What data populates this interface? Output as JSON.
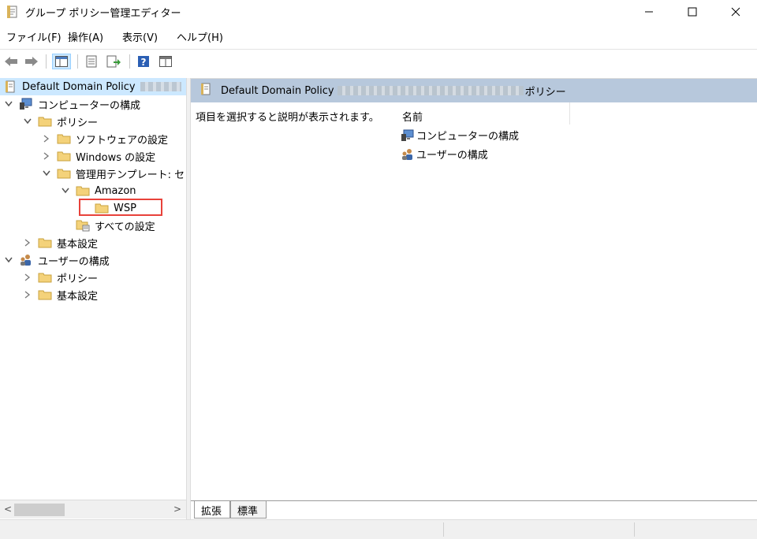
{
  "window": {
    "title": "グループ ポリシー管理エディター"
  },
  "menu": [
    "ファイル(F)",
    "操作(A)",
    "表示(V)",
    "ヘルプ(H)"
  ],
  "tree": {
    "root_label": "Default Domain Policy",
    "items": [
      {
        "label": "コンピューターの構成",
        "expander": "expanded"
      },
      {
        "label": "ポリシー",
        "expander": "expanded"
      },
      {
        "label": "ソフトウェアの設定",
        "expander": "collapsed"
      },
      {
        "label": "Windows の設定",
        "expander": "collapsed"
      },
      {
        "label": "管理用テンプレート: セン",
        "expander": "expanded"
      },
      {
        "label": "Amazon",
        "expander": "expanded"
      },
      {
        "label": "WSP",
        "expander": "none"
      },
      {
        "label": "すべての設定",
        "expander": "none"
      },
      {
        "label": "基本設定",
        "expander": "collapsed"
      },
      {
        "label": "ユーザーの構成",
        "expander": "expanded"
      },
      {
        "label": "ポリシー",
        "expander": "collapsed"
      },
      {
        "label": "基本設定",
        "expander": "collapsed"
      }
    ]
  },
  "detail": {
    "header_prefix": "Default Domain Policy",
    "header_suffix": "ポリシー",
    "description": "項目を選択すると説明が表示されます。",
    "column_name": "名前",
    "items": [
      "コンピューターの構成",
      "ユーザーの構成"
    ]
  },
  "tabs": [
    "拡張",
    "標準"
  ],
  "colors": {
    "accent": "#cce8ff",
    "header": "#b7c8dc",
    "highlight": "#e8423a",
    "folder": "#f4d27a"
  }
}
